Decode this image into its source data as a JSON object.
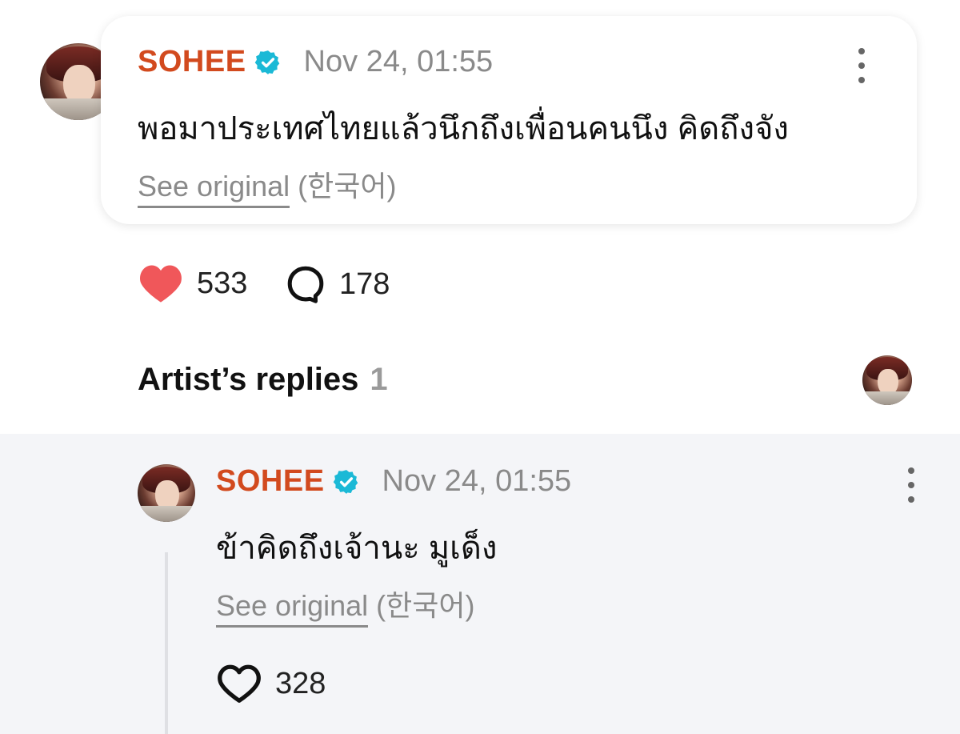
{
  "post": {
    "author": "SOHEE",
    "timestamp": "Nov 24, 01:55",
    "text": "พอมาประเทศไทยแล้วนึกถึงเพื่อนคนนึง คิดถึงจัง",
    "see_original": "See original",
    "original_language": "(한국어)",
    "likes": "533",
    "comments": "178"
  },
  "section": {
    "title": "Artist’s replies",
    "count": "1"
  },
  "reply": {
    "author": "SOHEE",
    "timestamp": "Nov 24, 01:55",
    "text": "ข้าคิดถึงเจ้านะ มูเด็ง",
    "see_original": "See original",
    "original_language": "(한국어)",
    "likes": "328"
  },
  "colors": {
    "author_name": "#d24a1e",
    "verified_badge": "#1bb9d6",
    "liked_heart": "#f0575a",
    "reply_background": "#f4f5f8"
  },
  "icons": {
    "verified": "verified-badge-icon",
    "more": "kebab-menu-icon",
    "like_filled": "heart-filled-icon",
    "like_outline": "heart-outline-icon",
    "comment": "comment-bubble-icon"
  }
}
